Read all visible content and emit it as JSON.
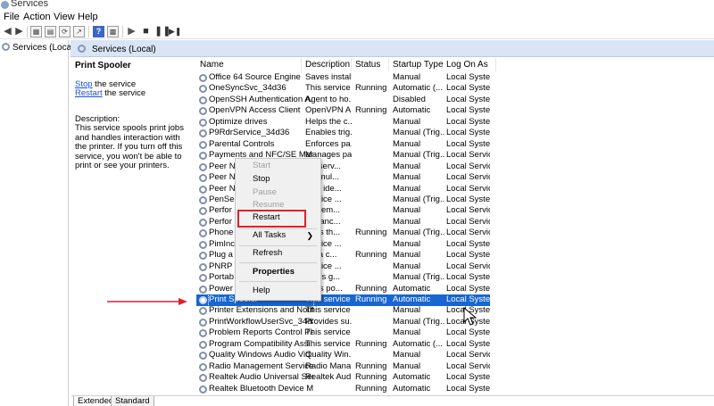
{
  "window": {
    "title": "Services"
  },
  "menu": [
    "File",
    "Action",
    "View",
    "Help"
  ],
  "left_tree": {
    "item": "Services (Local)"
  },
  "panel_header": "Services (Local)",
  "details": {
    "title": "Print Spooler",
    "stop_link": "Stop",
    "stop_suffix": " the service",
    "restart_link": "Restart",
    "restart_suffix": " the service",
    "description_label": "Description:",
    "description_text": "This service spools print jobs and handles interaction with the printer. If you turn off this service, you won't be able to print or see your printers."
  },
  "columns": [
    "Name",
    "Description",
    "Status",
    "Startup Type",
    "Log On As"
  ],
  "rows": [
    {
      "name": "Office 64 Source Engine",
      "desc": "Saves install...",
      "status": "",
      "startup": "Manual",
      "logon": "Local Syste..."
    },
    {
      "name": "OneSyncSvc_34d36",
      "desc": "This service ...",
      "status": "Running",
      "startup": "Automatic (...",
      "logon": "Local Syste..."
    },
    {
      "name": "OpenSSH Authentication A...",
      "desc": "Agent to ho...",
      "status": "",
      "startup": "Disabled",
      "logon": "Local Syste..."
    },
    {
      "name": "OpenVPN Access Client",
      "desc": "OpenVPN A...",
      "status": "Running",
      "startup": "Automatic",
      "logon": "Local Syste..."
    },
    {
      "name": "Optimize drives",
      "desc": "Helps the c...",
      "status": "",
      "startup": "Manual",
      "logon": "Local Syste..."
    },
    {
      "name": "P9RdrService_34d36",
      "desc": "Enables trig...",
      "status": "",
      "startup": "Manual (Trig...",
      "logon": "Local Syste..."
    },
    {
      "name": "Parental Controls",
      "desc": "Enforces pa...",
      "status": "",
      "startup": "Manual",
      "logon": "Local Syste..."
    },
    {
      "name": "Payments and NFC/SE Man...",
      "desc": "Manages pa...",
      "status": "",
      "startup": "Manual (Trig...",
      "logon": "Local Service"
    },
    {
      "name": "Peer N",
      "desc": "les serv...",
      "status": "",
      "startup": "Manual",
      "logon": "Local Service"
    },
    {
      "name": "Peer N",
      "desc": "les mul...",
      "status": "",
      "startup": "Manual",
      "logon": "Local Service"
    },
    {
      "name": "Peer N",
      "desc": "ides ide...",
      "status": "",
      "startup": "Manual",
      "logon": "Local Service"
    },
    {
      "name": "PenSer",
      "desc": "service ...",
      "status": "",
      "startup": "Manual (Trig...",
      "logon": "Local Syste..."
    },
    {
      "name": "Perfor",
      "desc": "les rem...",
      "status": "",
      "startup": "Manual",
      "logon": "Local Service"
    },
    {
      "name": "Perfor",
      "desc": "ormanc...",
      "status": "",
      "startup": "Manual",
      "logon": "Local Service"
    },
    {
      "name": "Phone",
      "desc": "ages th...",
      "status": "Running",
      "startup": "Manual (Trig...",
      "logon": "Local Service"
    },
    {
      "name": "PimInc",
      "desc": "service ...",
      "status": "",
      "startup": "Manual",
      "logon": "Local Syste..."
    },
    {
      "name": "Plug a",
      "desc": "les a c...",
      "status": "Running",
      "startup": "Manual",
      "logon": "Local Syste..."
    },
    {
      "name": "PNRP I",
      "desc": "service ...",
      "status": "",
      "startup": "Manual",
      "logon": "Local Service"
    },
    {
      "name": "Portab",
      "desc": "orces g...",
      "status": "",
      "startup": "Manual (Trig...",
      "logon": "Local Syste..."
    },
    {
      "name": "Power",
      "desc": "ages po...",
      "status": "Running",
      "startup": "Automatic",
      "logon": "Local Syste..."
    },
    {
      "name": "Print Spooler",
      "desc": "This service ...",
      "status": "Running",
      "startup": "Automatic",
      "logon": "Local Syste...",
      "selected": true
    },
    {
      "name": "Printer Extensions and Notif...",
      "desc": "This service ...",
      "status": "",
      "startup": "Manual",
      "logon": "Local Syste..."
    },
    {
      "name": "PrintWorkflowUserSvc_34d36",
      "desc": "Provides su...",
      "status": "",
      "startup": "Manual (Trig...",
      "logon": "Local Syste..."
    },
    {
      "name": "Problem Reports Control Pa...",
      "desc": "This service ...",
      "status": "",
      "startup": "Manual",
      "logon": "Local Syste..."
    },
    {
      "name": "Program Compatibility Assi...",
      "desc": "This service ...",
      "status": "Running",
      "startup": "Automatic (...",
      "logon": "Local Syste..."
    },
    {
      "name": "Quality Windows Audio Vid...",
      "desc": "Quality Win...",
      "status": "",
      "startup": "Manual",
      "logon": "Local Service"
    },
    {
      "name": "Radio Management Service",
      "desc": "Radio Mana...",
      "status": "Running",
      "startup": "Manual",
      "logon": "Local Service"
    },
    {
      "name": "Realtek Audio Universal Ser...",
      "desc": "Realtek Aud...",
      "status": "Running",
      "startup": "Automatic",
      "logon": "Local Syste..."
    },
    {
      "name": "Realtek Bluetooth Device M...",
      "desc": "",
      "status": "Running",
      "startup": "Automatic",
      "logon": "Local Syste..."
    }
  ],
  "context_menu": {
    "start": "Start",
    "stop": "Stop",
    "pause": "Pause",
    "resume": "Resume",
    "restart": "Restart",
    "all_tasks": "All Tasks",
    "refresh": "Refresh",
    "properties": "Properties",
    "help": "Help"
  },
  "tabs": [
    "Extended",
    "Standard"
  ],
  "colors": {
    "selection": "#1766d1",
    "highlight": "#d9232e",
    "annotation_arrow": "#e0202a",
    "header_strip": "#d9e4f5"
  },
  "icons": [
    "back-arrow-icon",
    "forward-arrow-icon",
    "console-tree-icon",
    "properties-icon",
    "refresh-icon",
    "export-icon",
    "help-icon",
    "play-icon",
    "stop-icon",
    "pause-icon",
    "restart-icon",
    "gear-icon"
  ]
}
